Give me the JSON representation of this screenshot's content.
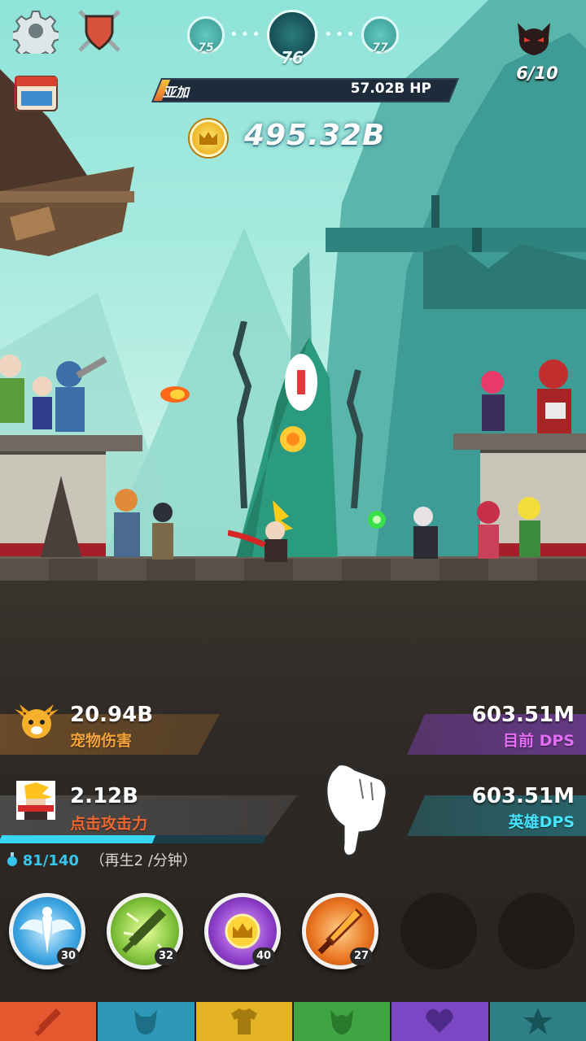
{
  "stage": {
    "previous": "75",
    "current": "76",
    "next": "77"
  },
  "boss": {
    "name": "亚加",
    "hp": "57.02B HP",
    "kills": "6/10"
  },
  "gold": {
    "amount": "495.32B"
  },
  "stats": {
    "pet_damage": {
      "value": "20.94B",
      "label": "宠物伤害"
    },
    "current_dps": {
      "value": "603.51M",
      "label": "目前 DPS"
    },
    "tap_damage": {
      "value": "2.12B",
      "label": "点击攻击力"
    },
    "hero_dps": {
      "value": "603.51M",
      "label": "英雄DPS"
    }
  },
  "mana": {
    "current": "81/140",
    "regen": "（再生2 /分钟）",
    "fill": 0.58
  },
  "skills": [
    {
      "icon": "angel-skill-icon",
      "level": "30",
      "color": "#3aa3e0"
    },
    {
      "icon": "sword-strike-skill-icon",
      "level": "32",
      "color": "#7fc23a"
    },
    {
      "icon": "gold-midas-skill-icon",
      "level": "40",
      "color": "#8e3fc9"
    },
    {
      "icon": "fire-sword-skill-icon",
      "level": "27",
      "color": "#e8731f"
    }
  ],
  "tabs": [
    {
      "icon": "sword-tab-icon",
      "color": "#e4582f"
    },
    {
      "icon": "helmet-tab-icon",
      "color": "#2e98b8"
    },
    {
      "icon": "armor-tab-icon",
      "color": "#e3b323"
    },
    {
      "icon": "pet-tab-icon",
      "color": "#3ea542"
    },
    {
      "icon": "heart-tab-icon",
      "color": "#7b47c4"
    },
    {
      "icon": "star-tab-icon",
      "color": "#2e7f86"
    }
  ]
}
